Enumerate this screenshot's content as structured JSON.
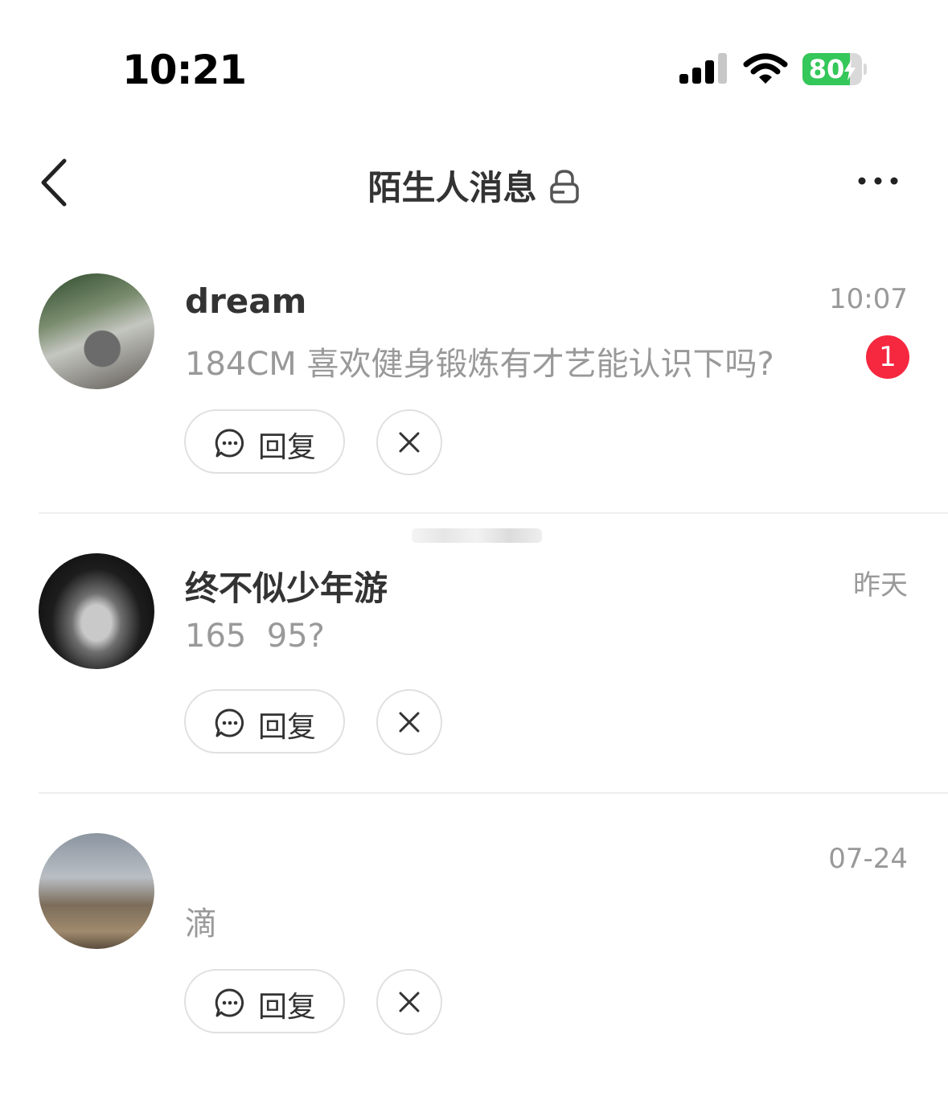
{
  "status_bar": {
    "time": "10:21",
    "battery_percent": 80,
    "battery_label": "80",
    "battery_color": "#34c759",
    "signal_icon": "cellular-signal-icon",
    "wifi_icon": "wifi-icon",
    "charging_icon": "lightning-bolt-icon"
  },
  "header": {
    "title": "陌生人消息",
    "back_icon": "chevron-left-icon",
    "lock_icon": "lock-icon",
    "more_icon": "more-horizontal-icon"
  },
  "messages": [
    {
      "name": "dream",
      "time": "10:07",
      "preview": "184CM 喜欢健身锻炼有才艺能认识下吗?",
      "unread_count": "1",
      "reply_label": "回复",
      "avatar": "avatar-image"
    },
    {
      "name": "终不似少年游",
      "time": "昨天",
      "preview": "165  95?",
      "reply_label": "回复",
      "avatar": "avatar-image"
    },
    {
      "name": "",
      "time": "07-24",
      "preview": "滴",
      "reply_label": "回复",
      "avatar": "avatar-image"
    }
  ],
  "colors": {
    "badge": "#f5283f",
    "muted_text": "#999999",
    "primary_text": "#333333",
    "divider": "#eeeeee"
  }
}
